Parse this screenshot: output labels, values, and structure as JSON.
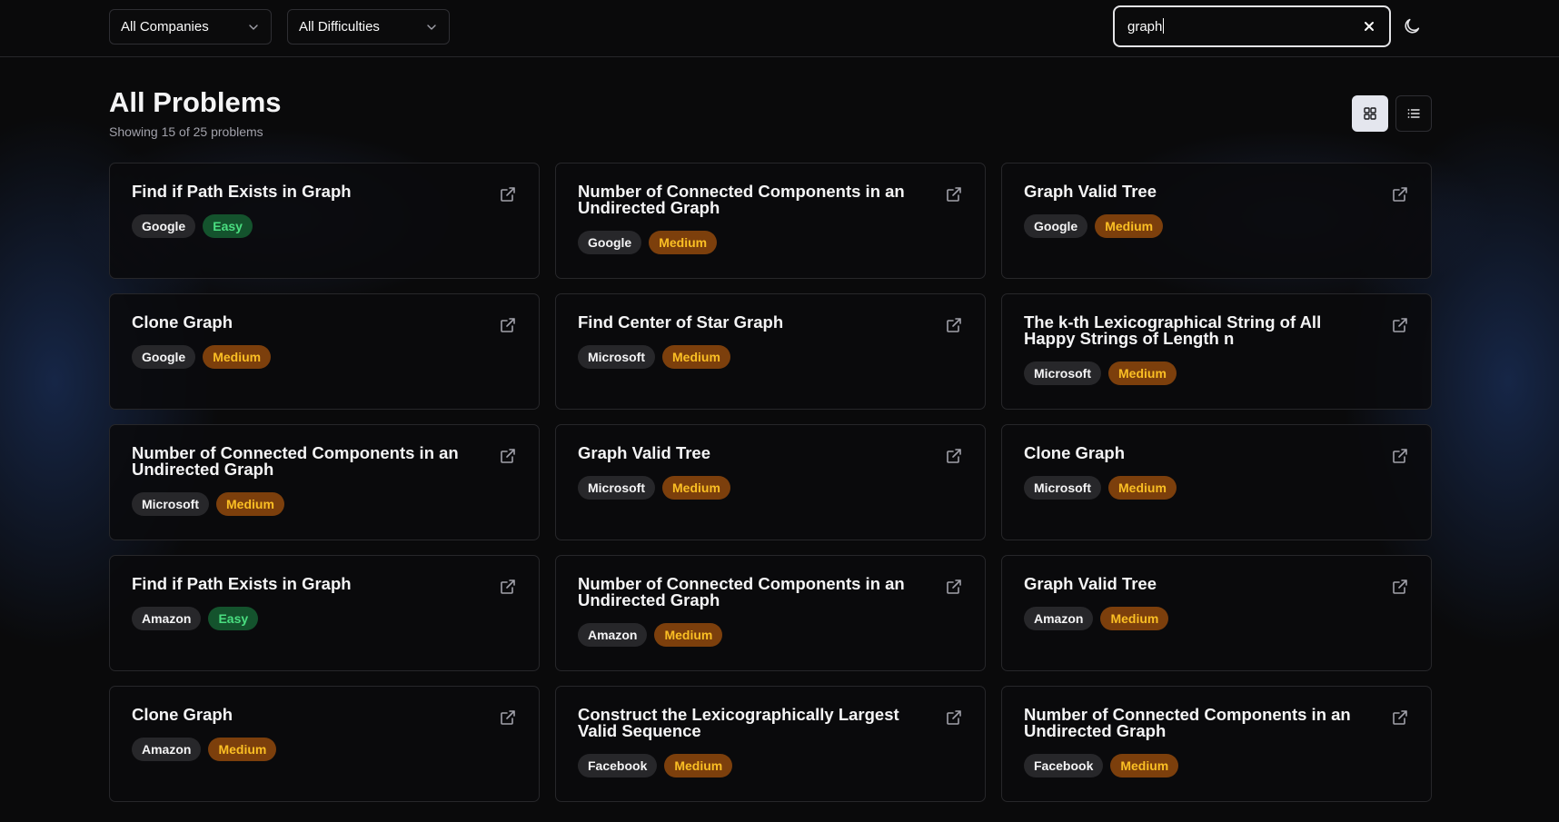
{
  "filters": {
    "company": "All Companies",
    "difficulty": "All Difficulties"
  },
  "search": {
    "value": "graph"
  },
  "page": {
    "title": "All Problems",
    "subtitle": "Showing 15 of 25 problems"
  },
  "colors": {
    "easy_bg": "#14532d",
    "easy_text": "#4ade80",
    "medium_bg": "#7c3f0c",
    "medium_text": "#fbbf24",
    "company_bg": "#27272a"
  },
  "problems": [
    {
      "title": "Find if Path Exists in Graph",
      "company": "Google",
      "difficulty": "Easy"
    },
    {
      "title": "Number of Connected Components in an Undirected Graph",
      "company": "Google",
      "difficulty": "Medium"
    },
    {
      "title": "Graph Valid Tree",
      "company": "Google",
      "difficulty": "Medium"
    },
    {
      "title": "Clone Graph",
      "company": "Google",
      "difficulty": "Medium"
    },
    {
      "title": "Find Center of Star Graph",
      "company": "Microsoft",
      "difficulty": "Medium"
    },
    {
      "title": "The k-th Lexicographical String of All Happy Strings of Length n",
      "company": "Microsoft",
      "difficulty": "Medium"
    },
    {
      "title": "Number of Connected Components in an Undirected Graph",
      "company": "Microsoft",
      "difficulty": "Medium"
    },
    {
      "title": "Graph Valid Tree",
      "company": "Microsoft",
      "difficulty": "Medium"
    },
    {
      "title": "Clone Graph",
      "company": "Microsoft",
      "difficulty": "Medium"
    },
    {
      "title": "Find if Path Exists in Graph",
      "company": "Amazon",
      "difficulty": "Easy"
    },
    {
      "title": "Number of Connected Components in an Undirected Graph",
      "company": "Amazon",
      "difficulty": "Medium"
    },
    {
      "title": "Graph Valid Tree",
      "company": "Amazon",
      "difficulty": "Medium"
    },
    {
      "title": "Clone Graph",
      "company": "Amazon",
      "difficulty": "Medium"
    },
    {
      "title": "Construct the Lexicographically Largest Valid Sequence",
      "company": "Facebook",
      "difficulty": "Medium"
    },
    {
      "title": "Number of Connected Components in an Undirected Graph",
      "company": "Facebook",
      "difficulty": "Medium"
    }
  ]
}
